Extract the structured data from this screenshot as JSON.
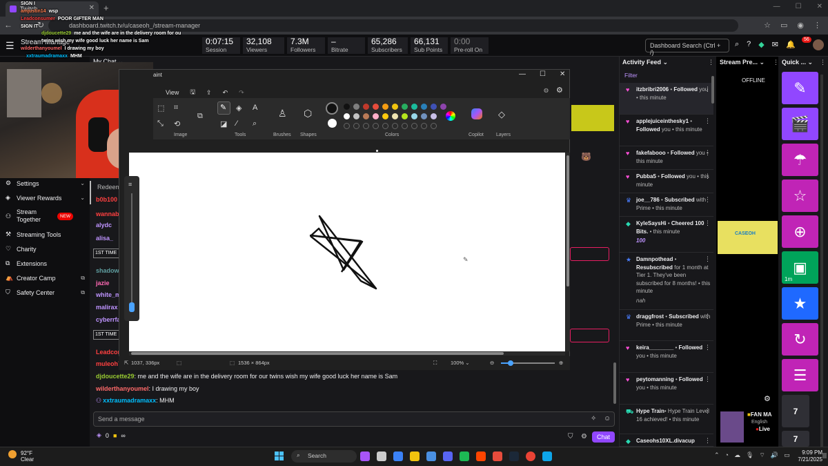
{
  "browser": {
    "tab_title": "Twitch",
    "url": "dashboard.twitch.tv/u/caseoh_/stream-manager"
  },
  "overlay_chat": [
    {
      "user": "",
      "text": "SIGN I",
      "color": "#c04cff"
    },
    {
      "user": "amjustin14",
      "text": "wsp",
      "color": "#ff7f50"
    },
    {
      "user": "Leadconsumer",
      "text": "POOR GIFTER MAN",
      "color": "#ff4040"
    },
    {
      "user": "",
      "text": "SIGN IT",
      "color": "#c04cff"
    },
    {
      "user": "djdoucette29",
      "text": "me and the wife are in the delivery room for ou",
      "color": "#9acd32"
    },
    {
      "user": "",
      "text": "twins wish my wife good luck her name is Sam",
      "color": "#efeff1"
    },
    {
      "user": "wilderthanyoumel",
      "text": "I drawing my boy",
      "color": "#ff6a6a"
    },
    {
      "user": "xxtraumadramaxx",
      "text": "MHM",
      "color": "#00bfff"
    }
  ],
  "header": {
    "title": "Stream Manage",
    "stats": [
      {
        "value": "0:07:15",
        "label": "Session"
      },
      {
        "value": "32,108",
        "label": "Viewers"
      },
      {
        "value": "7.3M",
        "label": "Followers"
      },
      {
        "value": "–",
        "label": "Bitrate"
      },
      {
        "value": "65,286",
        "label": "Subscribers"
      },
      {
        "value": "66,131",
        "label": "Sub Points"
      },
      {
        "value": "0:00",
        "label": "Pre-roll On"
      }
    ],
    "search_placeholder": "Dashboard Search (Ctrl + /)",
    "notifications": "56"
  },
  "sidebar": {
    "items": [
      {
        "label": "Settings",
        "icon": "gear-icon"
      },
      {
        "label": "Viewer Rewards",
        "icon": "reward-icon"
      },
      {
        "label": "Stream Together",
        "icon": "users-icon",
        "badge": "NEW"
      },
      {
        "label": "Streaming Tools",
        "icon": "tools-icon"
      },
      {
        "label": "Charity",
        "icon": "charity-icon"
      },
      {
        "label": "Extensions",
        "icon": "extensions-icon"
      },
      {
        "label": "Creator Camp",
        "icon": "camp-icon"
      },
      {
        "label": "Safety Center",
        "icon": "shield-icon"
      }
    ]
  },
  "chat": {
    "title": "My Chat",
    "redeem": "Redeem",
    "partial_users": [
      {
        "text": "b0b100",
        "color": "#ff4040"
      },
      {
        "text": "wannab",
        "color": "#ff4040"
      },
      {
        "text": "alydc",
        "color": "#bf94ff"
      },
      {
        "text": "alisa_",
        "color": "#bf94ff"
      },
      {
        "text": "shadow_",
        "color": "#5f9ea0"
      },
      {
        "text": "jazie",
        "color": "#ff69b4"
      },
      {
        "text": "white_m",
        "color": "#bf94ff"
      },
      {
        "text": "malirax",
        "color": "#bf94ff"
      },
      {
        "text": "cyberrfa",
        "color": "#bf94ff"
      },
      {
        "text": "Leadcon",
        "color": "#ff4040"
      },
      {
        "text": "muleoh7",
        "color": "#ff4040"
      }
    ],
    "first_time": "1ST TIME",
    "messages": [
      {
        "user": "djdoucette29",
        "text": ": me and the wife are in the delivery room for our twins wish my wife good luck her name is Sam",
        "color": "#9acd32"
      },
      {
        "user": "wilderthanyoumel",
        "text": ": I drawing my boy",
        "color": "#ff6a6a"
      },
      {
        "user": "xxtraumadramaxx",
        "text": ": MHM",
        "color": "#00bfff"
      }
    ],
    "input_placeholder": "Send a message",
    "points": "0",
    "infinity": "∞",
    "chat_button": "Chat"
  },
  "paint": {
    "title": "aint",
    "menu_view": "View",
    "groups": [
      "Image",
      "Tools",
      "Brushes",
      "Shapes",
      "Colors",
      "Copilot",
      "Layers"
    ],
    "cursor_pos": "1037, 336px",
    "canvas_size": "1536 × 864px",
    "zoom": "100%",
    "palette": [
      "#111111",
      "#7f7f7f",
      "#c0392b",
      "#e74c3c",
      "#f39c12",
      "#f1c40f",
      "#27ae60",
      "#1abc9c",
      "#2980b9",
      "#3f51b5",
      "#8e44ad"
    ],
    "palette2": [
      "#ffffff",
      "#c3c3c3",
      "#b97a57",
      "#ffaec9",
      "#ffc90e",
      "#efe4b0",
      "#b5e61d",
      "#99d9ea",
      "#7092be",
      "#c8bfe7"
    ]
  },
  "activity": {
    "title": "Activity Feed",
    "filter": "Filter",
    "items": [
      {
        "name": "itzbribri2006",
        "action": "Followed",
        "rest": " you • this minute",
        "icon": "heart-icon",
        "color": "#ff4fd8"
      },
      {
        "name": "applejuiceinthesky1",
        "action": "Followed",
        "rest": " you • this minute",
        "icon": "heart-icon",
        "color": "#ff4fd8"
      },
      {
        "name": "fakefabooo",
        "action": "Followed",
        "rest": " you • this minute",
        "icon": "heart-icon",
        "color": "#ff4fd8"
      },
      {
        "name": "Pubba5",
        "action": "Followed",
        "rest": " you • this minute",
        "icon": "heart-icon",
        "color": "#ff4fd8"
      },
      {
        "name": "joe__786",
        "action": "Subscribed",
        "rest": " with Prime • this minute",
        "icon": "crown-icon",
        "color": "#4a7dff"
      },
      {
        "name": "KyleSaysHi",
        "action": "Cheered 100 Bits.",
        "rest": " • this minute",
        "extra": "100",
        "icon": "bits-icon",
        "color": "#29d9b2"
      },
      {
        "name": "Damnpothead",
        "action": "Resubscribed",
        "rest": " for 1 month at Tier 1. They've been subscribed for 8 months! • this minute",
        "extra": "nah",
        "icon": "star-icon",
        "color": "#4a7dff"
      },
      {
        "name": "draggfrost",
        "action": "Subscribed",
        "rest": " with Prime • this minute",
        "icon": "crown-icon",
        "color": "#4a7dff"
      },
      {
        "name": "keira________",
        "action": "Followed",
        "rest": " you • this minute",
        "icon": "heart-icon",
        "color": "#ff4fd8"
      },
      {
        "name": "peytomanning",
        "action": "Followed",
        "rest": " you • this minute",
        "icon": "heart-icon",
        "color": "#ff4fd8"
      },
      {
        "name": "Hype Train",
        "action": "",
        "rest": "• Hype Train Level 16 achieved! • this minute",
        "icon": "train-icon",
        "color": "#29d9b2"
      },
      {
        "name": "Caseohs10XL.divacup",
        "action": "",
        "rest": "",
        "icon": "bits-icon",
        "color": "#29d9b2"
      }
    ]
  },
  "preview": {
    "title": "Stream Pre...",
    "offline": "OFFLINE",
    "thumb_text": "CASEOH",
    "fan_title": "FAN MA",
    "language": "English",
    "live": "Live"
  },
  "quick": {
    "title": "Quick ...",
    "actions": [
      {
        "icon": "pencil-icon",
        "color": "#9147ff",
        "glyph": "✎"
      },
      {
        "icon": "clapper-icon",
        "color": "#9147ff",
        "glyph": "🎬"
      },
      {
        "icon": "umbrella-icon",
        "color": "#c024b6",
        "glyph": "☂"
      },
      {
        "icon": "star-outline-icon",
        "color": "#c024b6",
        "glyph": "☆"
      },
      {
        "icon": "add-friend-icon",
        "color": "#c024b6",
        "glyph": "⊕"
      },
      {
        "icon": "ad-icon",
        "color": "#00a35a",
        "glyph": "▣",
        "sub": "1m"
      },
      {
        "icon": "star-filled-icon",
        "color": "#1f69ff",
        "glyph": "★"
      },
      {
        "icon": "replay-icon",
        "color": "#c024b6",
        "glyph": "↻"
      },
      {
        "icon": "stack-icon",
        "color": "#c024b6",
        "glyph": "☰"
      },
      {
        "icon": "seven-tv-icon",
        "color": "#2f2f35",
        "glyph": "7"
      },
      {
        "icon": "seven-tv-icon-2",
        "color": "#2f2f35",
        "glyph": "7"
      }
    ]
  },
  "taskbar": {
    "temp": "92°F",
    "condition": "Clear",
    "search": "Search",
    "time": "9:09 PM",
    "date": "7/21/2025"
  }
}
